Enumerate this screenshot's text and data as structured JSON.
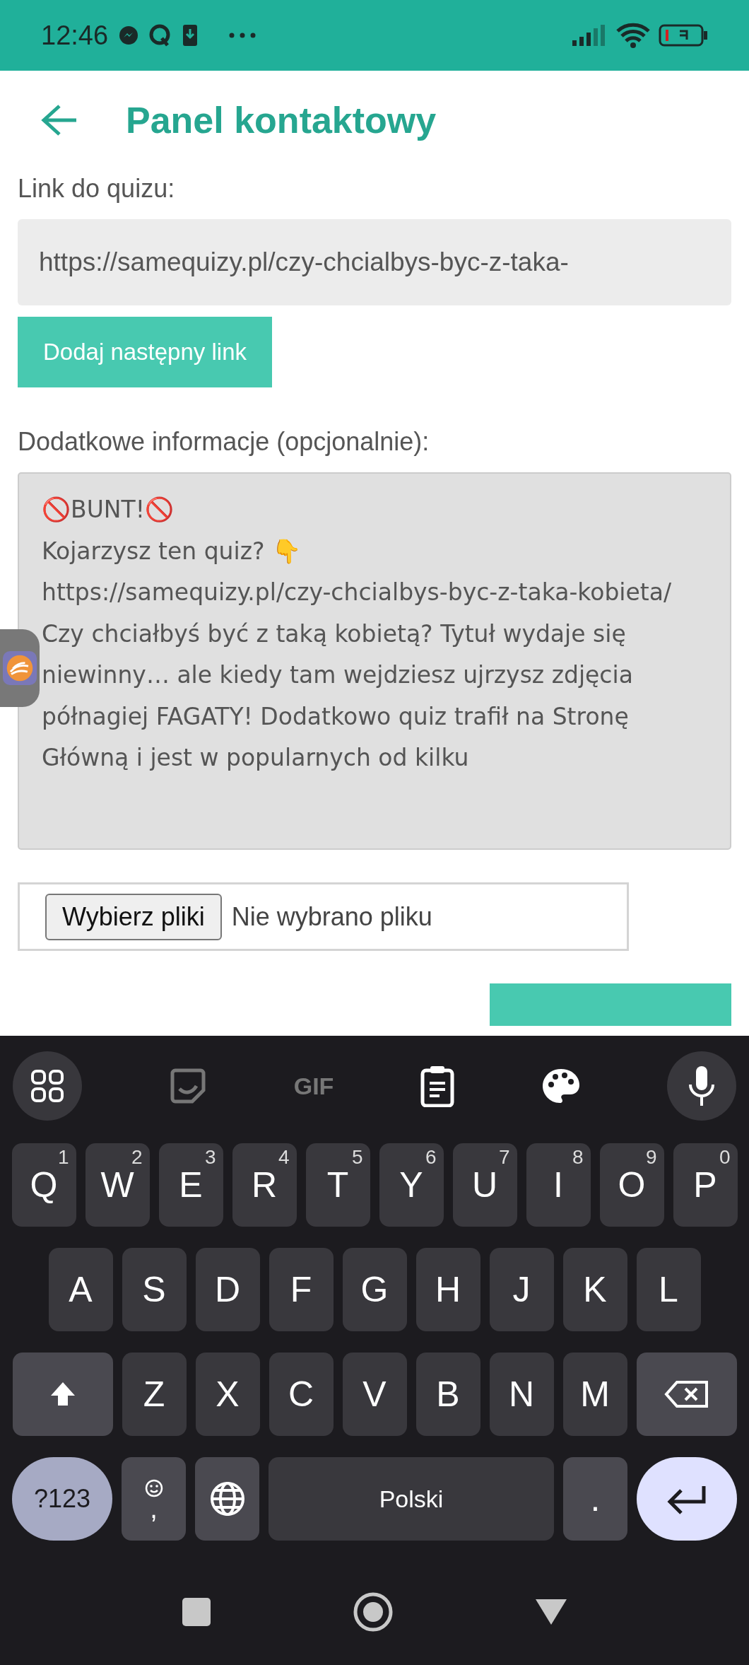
{
  "status_bar": {
    "time": "12:46"
  },
  "header": {
    "title": "Panel kontaktowy"
  },
  "form": {
    "link_label": "Link do quizu:",
    "link_value": "https://samequizy.pl/czy-chcialbys-byc-z-taka-",
    "add_link_button": "Dodaj następny link",
    "info_label": "Dodatkowe informacje (opcjonalnie):",
    "info_value": "🚫BUNT!🚫\nKojarzysz ten quiz? 👇\nhttps://samequizy.pl/czy-chcialbys-byc-z-taka-kobieta/\nCzy chciałbyś być z taką kobietą? Tytuł wydaje się niewinny… ale kiedy tam wejdziesz ujrzysz zdjęcia półnagiej FAGATY! Dodatkowo quiz trafił na Stronę Główną i jest w popularnych od kilku",
    "file_button": "Wybierz pliki",
    "file_status": "Nie wybrano pliku"
  },
  "keyboard": {
    "toolbar": [
      {
        "kind": "apps"
      },
      {
        "kind": "sticker"
      },
      {
        "kind": "gif",
        "label": "GIF"
      },
      {
        "kind": "clipboard"
      },
      {
        "kind": "palette"
      },
      {
        "kind": "mic"
      }
    ],
    "rows": [
      [
        {
          "label": "Q",
          "hint": "1"
        },
        {
          "label": "W",
          "hint": "2"
        },
        {
          "label": "E",
          "hint": "3"
        },
        {
          "label": "R",
          "hint": "4"
        },
        {
          "label": "T",
          "hint": "5"
        },
        {
          "label": "Y",
          "hint": "6"
        },
        {
          "label": "U",
          "hint": "7"
        },
        {
          "label": "I",
          "hint": "8"
        },
        {
          "label": "O",
          "hint": "9"
        },
        {
          "label": "P",
          "hint": "0"
        }
      ],
      [
        {
          "label": "A"
        },
        {
          "label": "S"
        },
        {
          "label": "D"
        },
        {
          "label": "F"
        },
        {
          "label": "G"
        },
        {
          "label": "H"
        },
        {
          "label": "J"
        },
        {
          "label": "K"
        },
        {
          "label": "L"
        }
      ],
      [
        {
          "kind": "shift"
        },
        {
          "label": "Z"
        },
        {
          "label": "X"
        },
        {
          "label": "C"
        },
        {
          "label": "V"
        },
        {
          "label": "B"
        },
        {
          "label": "N"
        },
        {
          "label": "M"
        },
        {
          "kind": "backspace"
        }
      ]
    ],
    "bottom_bar": {
      "symbols_key": "?123",
      "emoji_key": ",",
      "space_key": "Polski",
      "period_key": "."
    }
  }
}
